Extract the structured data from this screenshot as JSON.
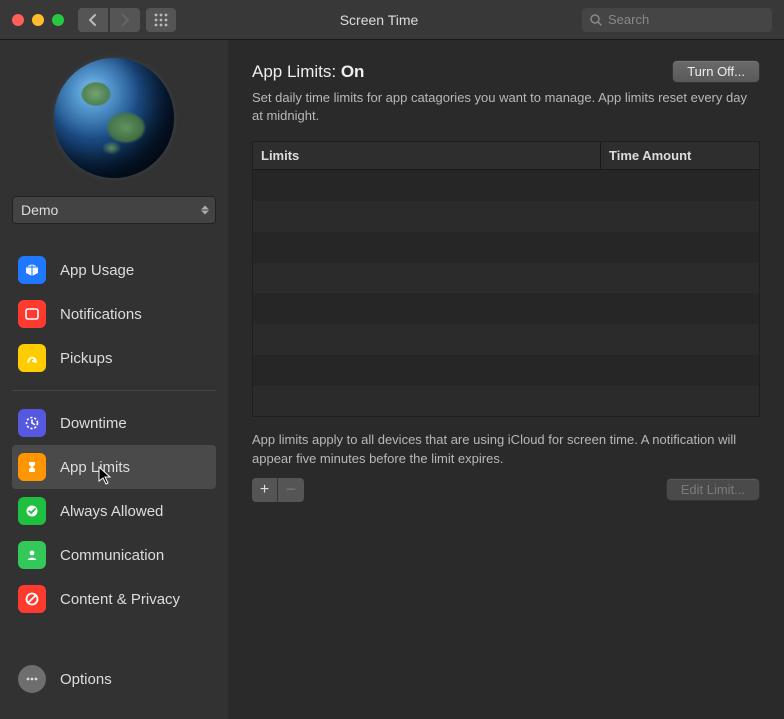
{
  "window": {
    "title": "Screen Time"
  },
  "search": {
    "placeholder": "Search"
  },
  "user_select": {
    "value": "Demo"
  },
  "sidebar": {
    "items": [
      {
        "label": "App Usage"
      },
      {
        "label": "Notifications"
      },
      {
        "label": "Pickups"
      },
      {
        "label": "Downtime"
      },
      {
        "label": "App Limits"
      },
      {
        "label": "Always Allowed"
      },
      {
        "label": "Communication"
      },
      {
        "label": "Content & Privacy"
      }
    ],
    "options_label": "Options"
  },
  "content": {
    "title_prefix": "App Limits: ",
    "title_state": "On",
    "turn_off_label": "Turn Off...",
    "description": "Set daily time limits for app catagories you want to manage. App limits reset every day at midnight.",
    "columns": {
      "limits": "Limits",
      "time": "Time Amount"
    },
    "footnote": "App limits apply to all devices that are using iCloud for screen time. A notification will appear five minutes before the limit expires.",
    "add_label": "+",
    "remove_label": "−",
    "edit_label": "Edit Limit..."
  },
  "colors": {
    "blue": "#1f78ff",
    "red": "#ff3b30",
    "yellow": "#ffcc00",
    "purple": "#5658e0",
    "orange": "#ff9500",
    "green": "#1fbf3f",
    "green2": "#34c759",
    "gray": "#6e6e6e"
  }
}
